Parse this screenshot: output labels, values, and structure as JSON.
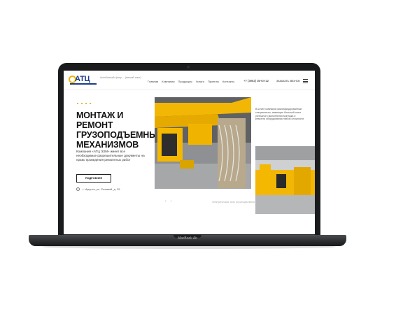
{
  "device": {
    "label": "MacBook Air"
  },
  "site": {
    "logo_text": "АТЦ",
    "tagline": "Актюбинский Центр ... (мелкий текст)",
    "nav": [
      "Главная",
      "Компания",
      "Продукция",
      "Услуги",
      "Проекты",
      "Контакты"
    ],
    "phone": "+7 (3952) 35-64-12",
    "order_label": "ЗАКАЗАТЬ ЗВОНОК"
  },
  "hero": {
    "title": "МОНТАЖ И РЕМОНТ ГРУЗОПОДЪЕМНЫХ МЕХАНИЗМОВ",
    "description": "Компания «АТЦ ЭЗМ» имеет все необходимые разрешительные документы на право проведения ремонтных работ",
    "button_label": "ПОДРОБНЕЕ",
    "address": "г. Иркутск, ул. Розовый, д. 25",
    "caption": "электрическая таль грузоподъемная",
    "side_text": "В штате компании квалифицированные специалисты, имеющие большой опыт успешного выполнения монтажа и ремонта оборудования любой сложности"
  },
  "colors": {
    "accent": "#f0b400",
    "brand": "#1d3c8c"
  }
}
